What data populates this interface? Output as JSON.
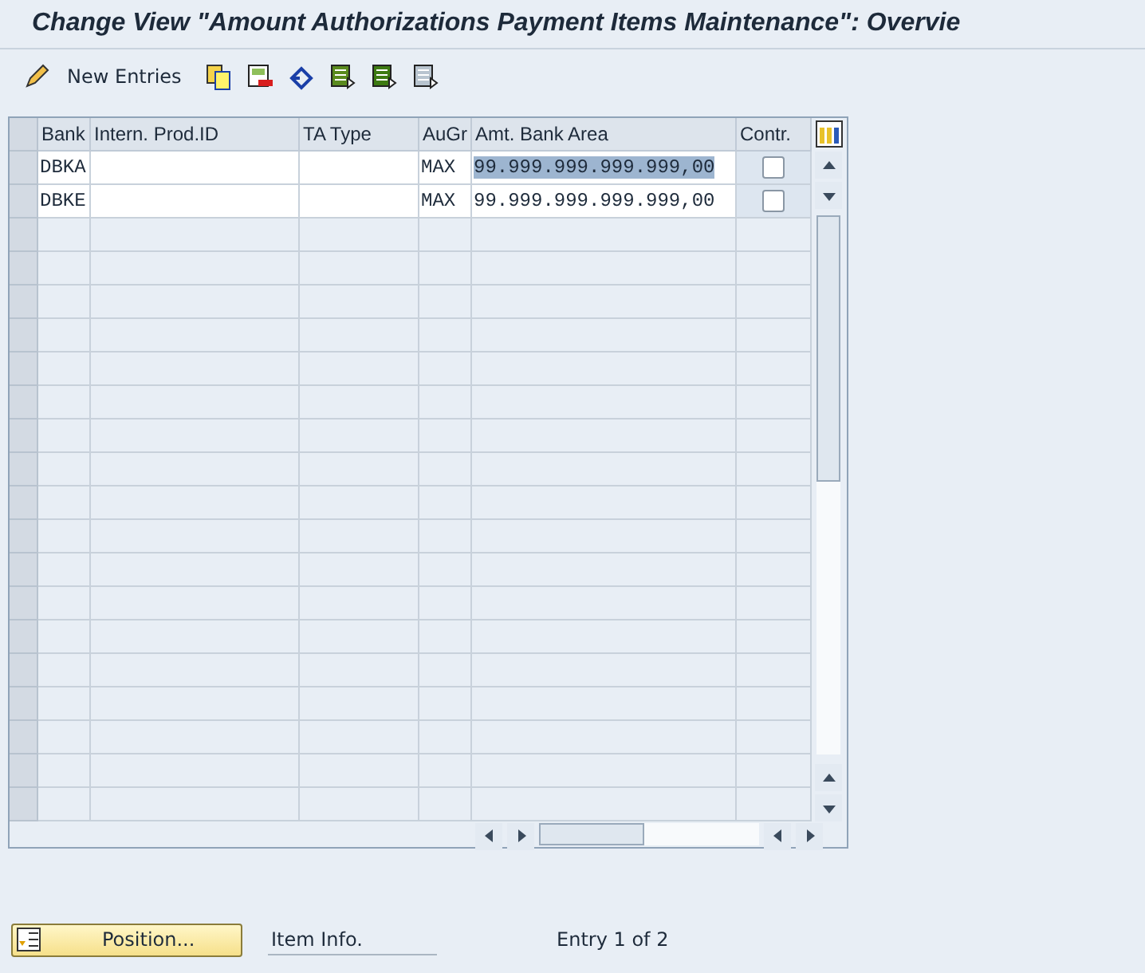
{
  "window": {
    "title": "Change View \"Amount Authorizations Payment Items Maintenance\": Overvie"
  },
  "toolbar": {
    "new_entries": "New Entries"
  },
  "table": {
    "columns": [
      "Bank",
      "Intern. Prod.ID",
      "TA Type",
      "AuGr",
      "Amt. Bank Area",
      "Contr."
    ],
    "rows": [
      {
        "cells": [
          "DBKA",
          "",
          "",
          "MAX",
          "99.999.999.999.999,00"
        ],
        "amount_selected": true,
        "contr_checked": false
      },
      {
        "cells": [
          "DBKE",
          "",
          "",
          "MAX",
          "99.999.999.999.999,00"
        ],
        "amount_selected": false,
        "contr_checked": false
      }
    ]
  },
  "footer": {
    "position_button": "Position...",
    "item_info": "Item Info.",
    "entry_count": "Entry 1 of 2"
  }
}
